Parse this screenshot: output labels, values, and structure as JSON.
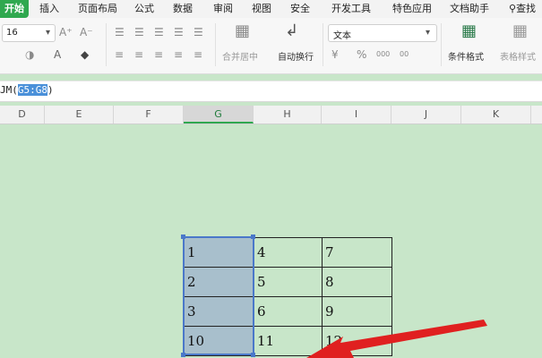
{
  "tabs": [
    "开始",
    "插入",
    "页面布局",
    "公式",
    "数据",
    "审阅",
    "视图",
    "安全",
    "开发工具",
    "特色应用",
    "文档助手",
    "查找"
  ],
  "ribbon": {
    "font_size": "16",
    "number_format": "文本",
    "merge_label": "合并居中",
    "wrap_label": "自动换行",
    "cond_format_label": "条件格式",
    "table_style_label": "表格样式",
    "percent": "%",
    "dec_inc": "000",
    "dec_dec": "00"
  },
  "formula": {
    "prefix": "JM(",
    "selected": "G5:G8",
    "suffix": ")"
  },
  "columns": [
    "D",
    "E",
    "F",
    "G",
    "H",
    "I",
    "J",
    "K"
  ],
  "selected_column": "G",
  "table": [
    [
      "1",
      "4",
      "7"
    ],
    [
      "2",
      "5",
      "8"
    ],
    [
      "3",
      "6",
      "9"
    ],
    [
      "10",
      "11",
      "12"
    ]
  ],
  "colors": {
    "accent": "#2fa84f",
    "sheet": "#c8e6c9",
    "selection": "#4a78c9",
    "arrow": "#e02020"
  }
}
